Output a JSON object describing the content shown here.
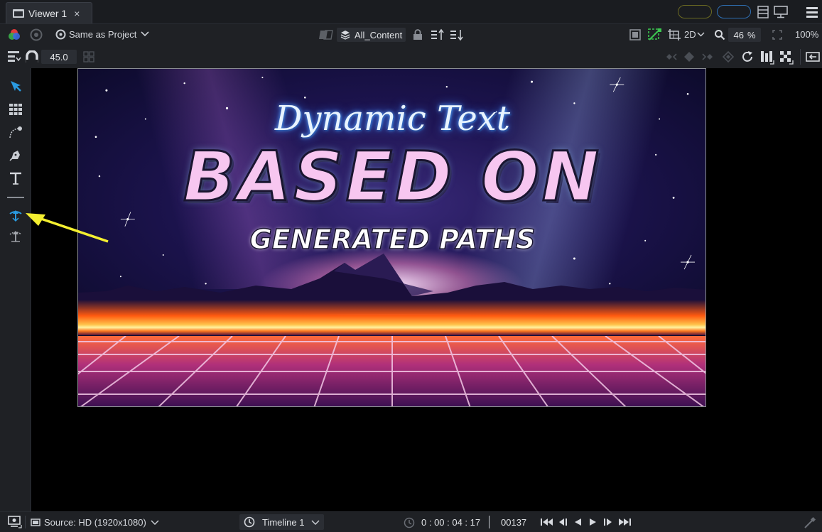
{
  "tab": {
    "title": "Viewer 1",
    "close": "×"
  },
  "toolbar": {
    "color_mode": "Same as Project",
    "layer_filter": "All_Content",
    "view_mode": "2D",
    "zoom_value": "46",
    "zoom_unit": "%",
    "fit_value": "100%",
    "snap_angle": "45.0"
  },
  "canvas": {
    "script_line": "Dynamic Text",
    "headline": "BASED ON",
    "tagline": "GENERATED PATHS"
  },
  "bottombar": {
    "source": "Source: HD (1920x1080)",
    "timeline": "Timeline 1",
    "timecode": "0 : 00 : 04 : 17",
    "frame": "00137"
  },
  "colors": {
    "accent": "#2a9ae0",
    "arrow": "#f4ef30"
  },
  "icons": {
    "select_tool": "arrow-cursor-icon",
    "grid_tool": "grid-icon",
    "path_tool": "freehand-path-icon",
    "pen_tool": "pen-icon",
    "text_tool": "text-tool-icon",
    "generate_path_tool": "generate-path-icon",
    "transform_tool": "transform-anchor-icon"
  }
}
